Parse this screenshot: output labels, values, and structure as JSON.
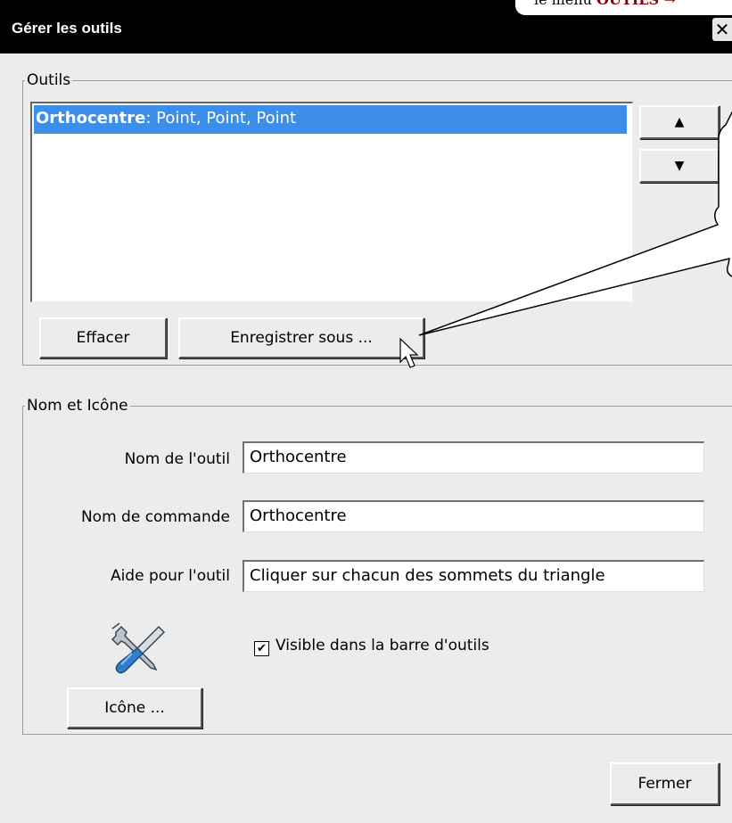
{
  "window": {
    "title": "Gérer les outils",
    "close_label": "✕"
  },
  "annotation": {
    "top_text_prefix": "le menu ",
    "top_text_strong": "OUTILS →"
  },
  "tools_group": {
    "legend": "Outils",
    "items": [
      {
        "name": "Orthocentre",
        "signature": ": Point, Point, Point",
        "selected": true
      }
    ],
    "move_up_label": "▲",
    "move_down_label": "▼",
    "delete_label": "Effacer",
    "save_as_label": "Enregistrer sous ..."
  },
  "name_icon_group": {
    "legend": "Nom et Icône",
    "tool_name_label": "Nom de l'outil",
    "tool_name_value": "Orthocentre",
    "command_name_label": "Nom de commande",
    "command_name_value": "Orthocentre",
    "tool_help_label": "Aide pour l'outil",
    "tool_help_value": "Cliquer  sur chacun des sommets du triangle",
    "icon_name": "wrench-screwdriver-icon",
    "visible_checkbox_label": "Visible dans la barre d'outils",
    "visible_checked": true,
    "icon_button_label": "Icône ..."
  },
  "footer": {
    "close_label": "Fermer"
  },
  "colors": {
    "selection": "#3d8ee8",
    "titlebar": "#000000",
    "dialog_bg": "#ececec",
    "accent_dark_red": "#8b0000"
  }
}
